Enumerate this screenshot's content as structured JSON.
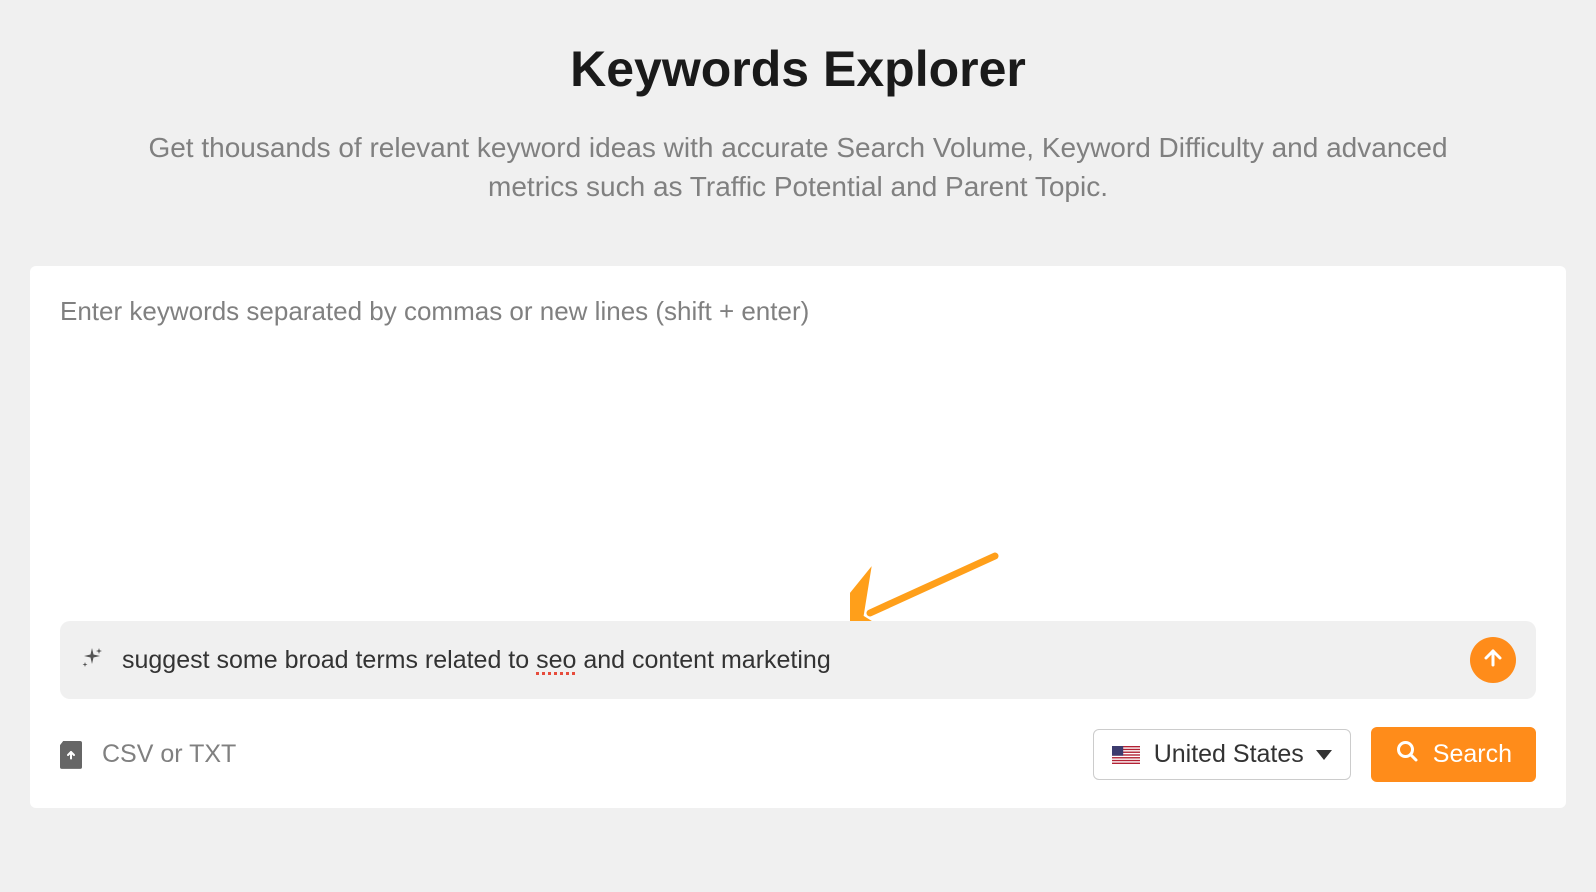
{
  "header": {
    "title": "Keywords Explorer",
    "subtitle": "Get thousands of relevant keyword ideas with accurate Search Volume, Keyword Difficulty and advanced metrics such as Traffic Potential and Parent Topic."
  },
  "keywords_input": {
    "placeholder": "Enter keywords separated by commas or new lines (shift + enter)",
    "value": ""
  },
  "ai_suggest": {
    "text_before": "suggest some broad terms related to ",
    "spellcheck_word": "seo",
    "text_after": " and content marketing",
    "icon": "sparkle-icon",
    "submit_icon": "arrow-up-icon"
  },
  "upload": {
    "label": "CSV or TXT",
    "icon": "file-upload-icon"
  },
  "country_selector": {
    "selected": "United States",
    "flag": "us-flag-icon"
  },
  "search_button": {
    "label": "Search",
    "icon": "search-icon"
  },
  "colors": {
    "accent": "#ff8c1a",
    "text_muted": "#808080",
    "bg": "#f0f0f0"
  }
}
